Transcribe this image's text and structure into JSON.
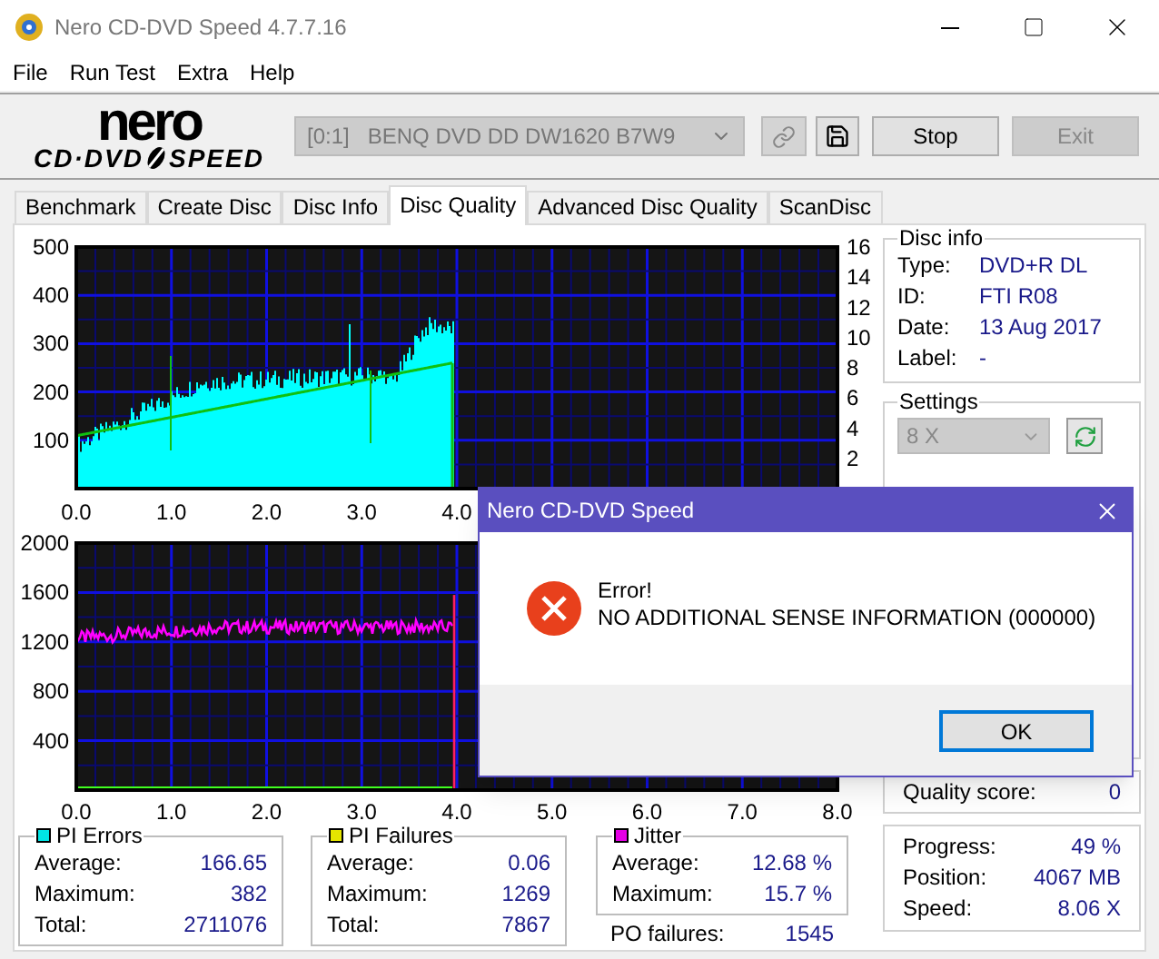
{
  "window": {
    "title": "Nero CD-DVD Speed 4.7.7.16"
  },
  "menu": [
    "File",
    "Run Test",
    "Extra",
    "Help"
  ],
  "logo": {
    "word": "nero",
    "left": "CD·DVD",
    "right": "SPEED"
  },
  "toolbar": {
    "drive": "[0:1]   BENQ DVD DD DW1620 B7W9",
    "drive_disabled": true,
    "buttons": [
      {
        "label": "Stop",
        "disabled": false
      },
      {
        "label": "Exit",
        "disabled": true
      }
    ]
  },
  "tabs": [
    {
      "label": "Benchmark",
      "selected": false
    },
    {
      "label": "Create Disc",
      "selected": false
    },
    {
      "label": "Disc Info",
      "selected": false
    },
    {
      "label": "Disc Quality",
      "selected": true
    },
    {
      "label": "Advanced Disc Quality",
      "selected": false
    },
    {
      "label": "ScanDisc",
      "selected": false
    }
  ],
  "chart_top": {
    "y_ticks": [
      "500",
      "400",
      "300",
      "200",
      "100"
    ],
    "right_ticks": [
      "16",
      "14",
      "12",
      "10",
      "8",
      "6",
      "4",
      "2"
    ],
    "x_ticks": [
      "0.0",
      "1.0",
      "2.0",
      "3.0",
      "4.0"
    ]
  },
  "chart_bottom": {
    "y_ticks": [
      "2000",
      "1600",
      "1200",
      "800",
      "400"
    ],
    "x_ticks": [
      "0.0",
      "1.0",
      "2.0",
      "3.0",
      "4.0",
      "5.0",
      "6.0",
      "7.0",
      "8.0"
    ]
  },
  "disc_info": {
    "title": "Disc info",
    "rows": [
      {
        "label": "Type:",
        "value": "DVD+R DL"
      },
      {
        "label": "ID:",
        "value": "FTI R08"
      },
      {
        "label": "Date:",
        "value": "13 Aug 2017"
      },
      {
        "label": "Label:",
        "value": "-"
      }
    ]
  },
  "settings": {
    "title": "Settings",
    "speed": "8 X",
    "speed_disabled": true
  },
  "quality_score": {
    "label": "Quality score:",
    "value": "0"
  },
  "stats": [
    {
      "title": "PI Errors",
      "color": "#00e5e5",
      "rows": [
        {
          "label": "Average:",
          "value": "166.65"
        },
        {
          "label": "Maximum:",
          "value": "382"
        },
        {
          "label": "Total:",
          "value": "2711076"
        }
      ]
    },
    {
      "title": "PI Failures",
      "color": "#e5e500",
      "rows": [
        {
          "label": "Average:",
          "value": "0.06"
        },
        {
          "label": "Maximum:",
          "value": "1269"
        },
        {
          "label": "Total:",
          "value": "7867"
        }
      ]
    },
    {
      "title": "Jitter",
      "color": "#e500e5",
      "rows": [
        {
          "label": "Average:",
          "value": "12.68 %"
        },
        {
          "label": "Maximum:",
          "value": "15.7 %"
        }
      ]
    }
  ],
  "po_failures": {
    "label": "PO failures:",
    "value": "1545"
  },
  "progress": [
    {
      "label": "Progress:",
      "value": "49 %"
    },
    {
      "label": "Position:",
      "value": "4067 MB"
    },
    {
      "label": "Speed:",
      "value": "8.06 X"
    }
  ],
  "dialog": {
    "title": "Nero CD-DVD Speed",
    "heading": "Error!",
    "message": "NO ADDITIONAL SENSE INFORMATION (000000)",
    "button": "OK"
  }
}
